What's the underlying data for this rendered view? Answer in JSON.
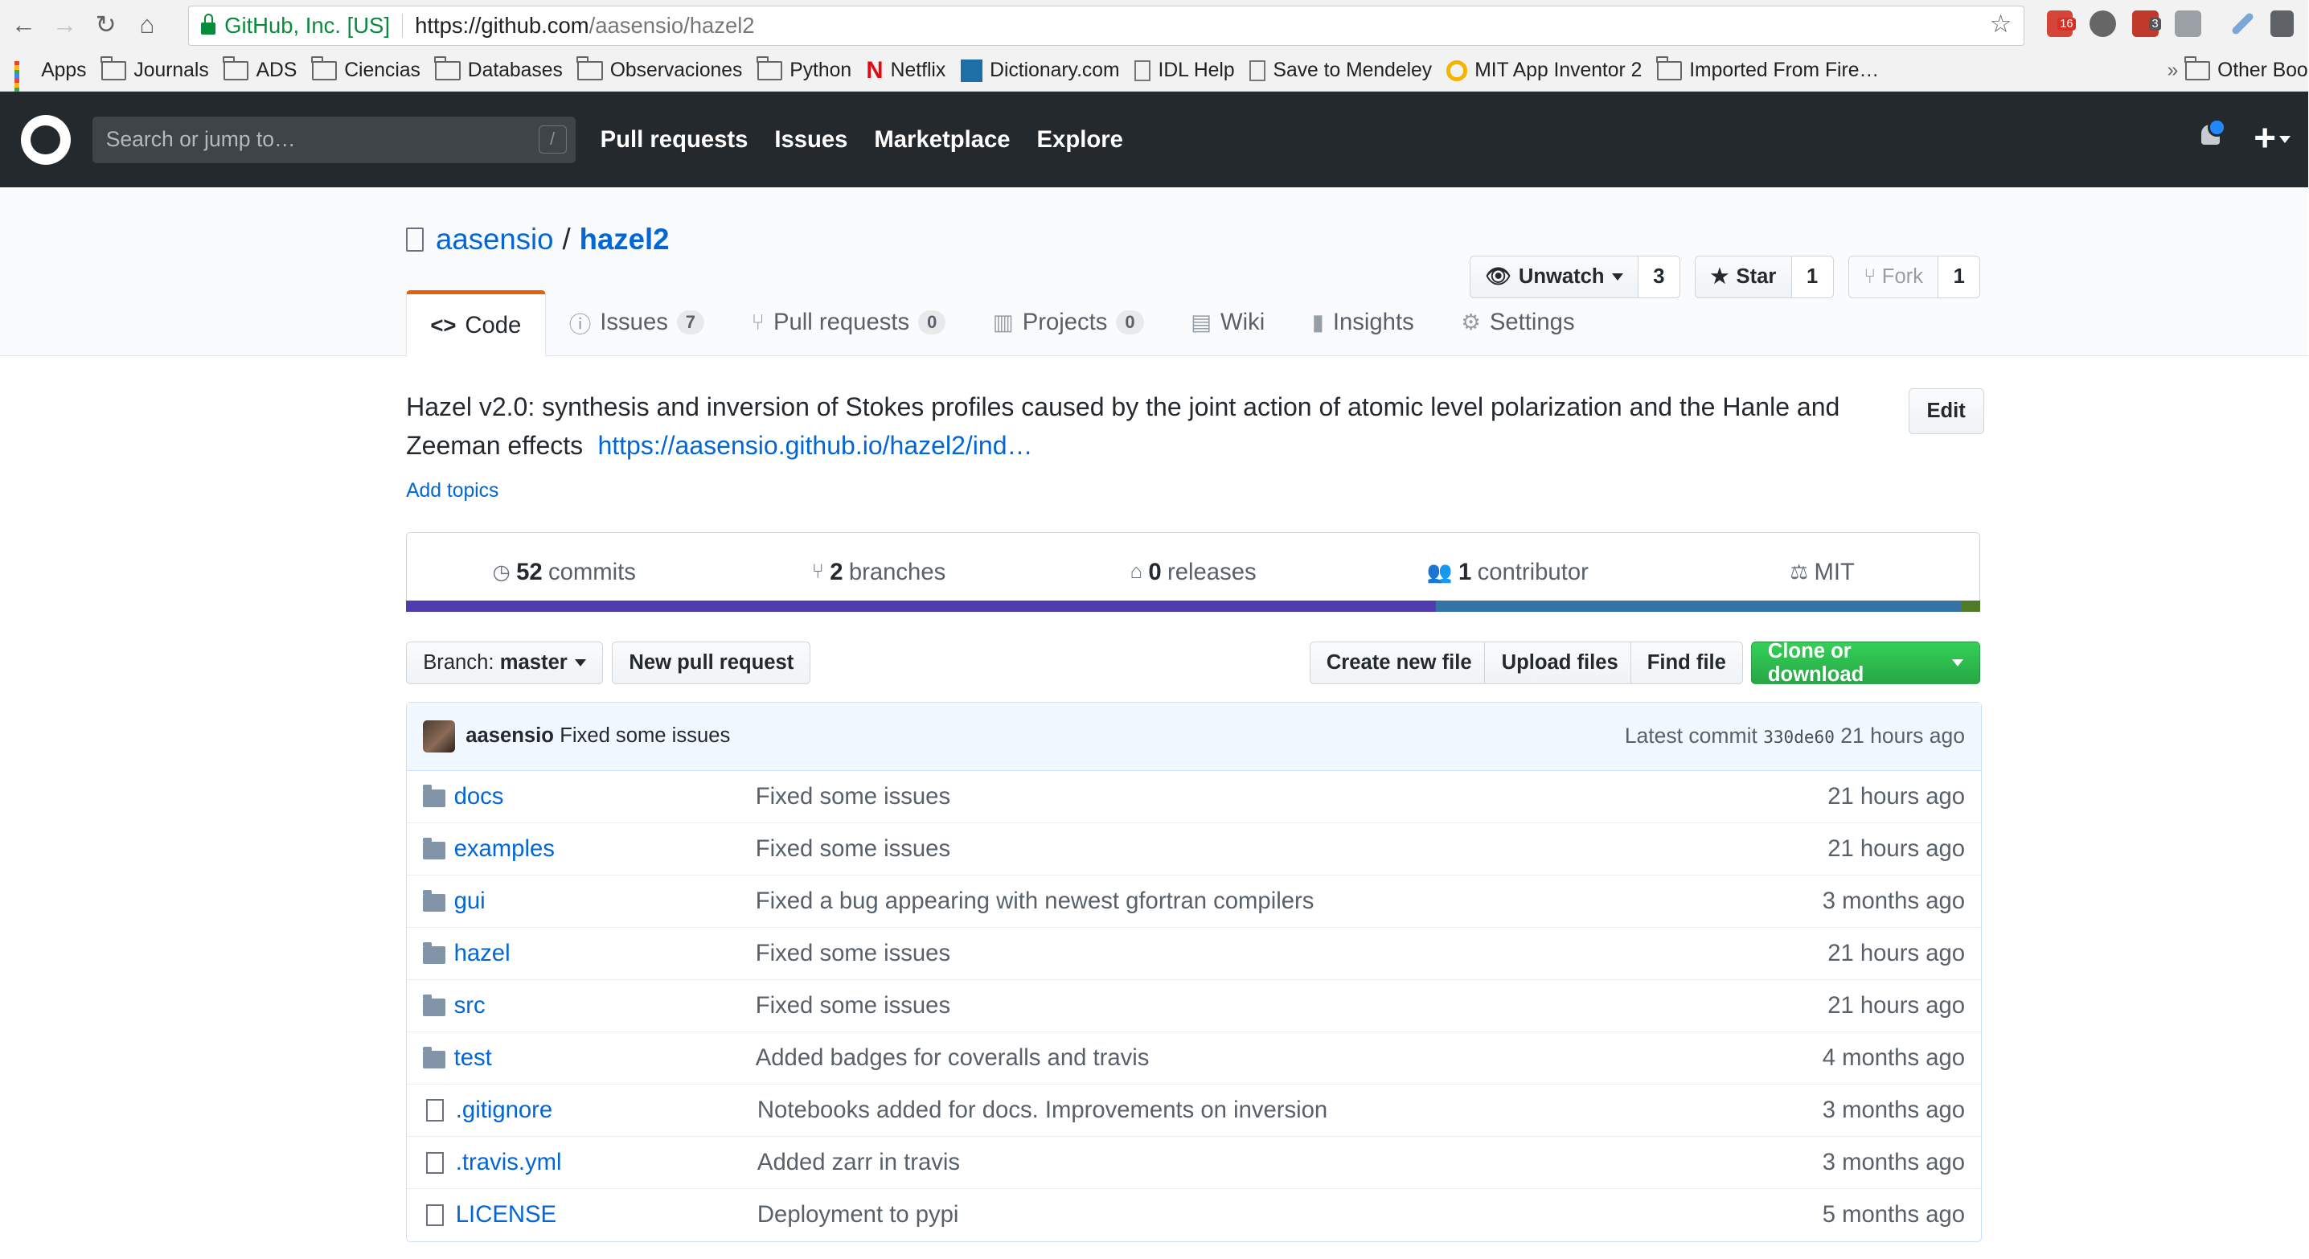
{
  "browser": {
    "secure_label": "GitHub, Inc. [US]",
    "url_host": "https://github.com",
    "url_path": "/aasensio/hazel2",
    "badge_gmail": "16",
    "badge_ext": "3",
    "bookmarks": [
      "Apps",
      "Journals",
      "ADS",
      "Ciencias",
      "Databases",
      "Observaciones",
      "Python",
      "Netflix",
      "Dictionary.com",
      "IDL Help",
      "Save to Mendeley",
      "MIT App Inventor 2",
      "Imported From Fire…",
      "Other Boo"
    ],
    "bookmarks_overflow": "»"
  },
  "header": {
    "search_placeholder": "Search or jump to…",
    "slash_key": "/",
    "nav": [
      "Pull requests",
      "Issues",
      "Marketplace",
      "Explore"
    ],
    "plus": "+"
  },
  "repo": {
    "owner": "aasensio",
    "separator": "/",
    "name": "hazel2",
    "unwatch_label": "Unwatch",
    "watch_count": "3",
    "star_label": "Star",
    "star_count": "1",
    "fork_label": "Fork",
    "fork_count": "1",
    "tabs": [
      {
        "label": "Code",
        "icon": "<>",
        "count": ""
      },
      {
        "label": "Issues",
        "icon": "ⓘ",
        "count": "7"
      },
      {
        "label": "Pull requests",
        "icon": "⑂",
        "count": "0"
      },
      {
        "label": "Projects",
        "icon": "▥",
        "count": "0"
      },
      {
        "label": "Wiki",
        "icon": "▤",
        "count": ""
      },
      {
        "label": "Insights",
        "icon": "▮",
        "count": ""
      },
      {
        "label": "Settings",
        "icon": "⚙",
        "count": ""
      }
    ],
    "description": "Hazel v2.0: synthesis and inversion of Stokes profiles caused by the joint action of atomic level polarization and the Hanle and Zeeman effects",
    "homepage": "https://aasensio.github.io/hazel2/ind…",
    "edit_label": "Edit",
    "add_topics": "Add topics",
    "summary": {
      "commits_num": "52",
      "commits_label": "commits",
      "branches_num": "2",
      "branches_label": "branches",
      "releases_num": "0",
      "releases_label": "releases",
      "contrib_num": "1",
      "contrib_label": "contributor",
      "license": "MIT"
    },
    "languages": [
      {
        "color": "#4F3CAF",
        "share": 0.654
      },
      {
        "color": "#3572A5",
        "share": 0.334
      },
      {
        "color": "#4F7A28",
        "share": 0.012
      }
    ],
    "branch_label": "Branch:",
    "branch_name": "master",
    "new_pr": "New pull request",
    "create_file": "Create new file",
    "upload_files": "Upload files",
    "find_file": "Find file",
    "clone": "Clone or download",
    "latest_commit": {
      "author": "aasensio",
      "message": "Fixed some issues",
      "prefix": "Latest commit",
      "sha": "330de60",
      "age": "21 hours ago"
    },
    "files": [
      {
        "type": "dir",
        "name": "docs",
        "message": "Fixed some issues",
        "age": "21 hours ago"
      },
      {
        "type": "dir",
        "name": "examples",
        "message": "Fixed some issues",
        "age": "21 hours ago"
      },
      {
        "type": "dir",
        "name": "gui",
        "message": "Fixed a bug appearing with newest gfortran compilers",
        "age": "3 months ago"
      },
      {
        "type": "dir",
        "name": "hazel",
        "message": "Fixed some issues",
        "age": "21 hours ago"
      },
      {
        "type": "dir",
        "name": "src",
        "message": "Fixed some issues",
        "age": "21 hours ago"
      },
      {
        "type": "dir",
        "name": "test",
        "message": "Added badges for coveralls and travis",
        "age": "4 months ago"
      },
      {
        "type": "file",
        "name": ".gitignore",
        "message": "Notebooks added for docs. Improvements on inversion",
        "age": "3 months ago"
      },
      {
        "type": "file",
        "name": ".travis.yml",
        "message": "Added zarr in travis",
        "age": "3 months ago"
      },
      {
        "type": "file",
        "name": "LICENSE",
        "message": "Deployment to pypi",
        "age": "5 months ago"
      }
    ]
  }
}
